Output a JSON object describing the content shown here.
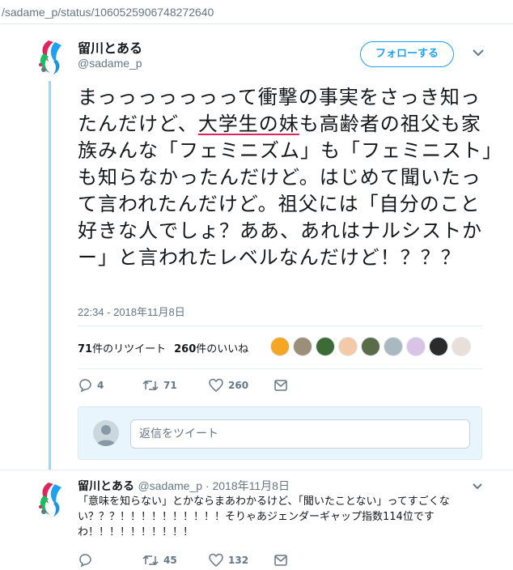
{
  "browser": {
    "url": "/sadame_p/status/1060525906748272640"
  },
  "tweet": {
    "display_name": "留川とある",
    "handle": "@sadame_p",
    "follow_label": "フォローする",
    "text_before": "まっっっっっっって衝撃の事実をさっき知ったんだけど、",
    "text_highlight": "大学生の妹",
    "text_after": "も高齢者の祖父も家族みんな「フェミニズム」も「フェミニスト」も知らなかったんだけど。はじめて聞いたって言われたんだけど。祖父には「自分のこと好きな人でしょ？ああ、あれはナルシストかー」と言われたレベルなんだけど！？？？",
    "timestamp": "22:34 - 2018年11月8日",
    "retweet_count": "71",
    "retweet_suffix": "件のリツイート",
    "like_count": "260",
    "like_suffix": "件のいいね",
    "likers": [
      {
        "color": "#f5a623"
      },
      {
        "color": "#9b8f7a"
      },
      {
        "color": "#3d6b35"
      },
      {
        "color": "#f4c9a8"
      },
      {
        "color": "#5a6b4a"
      },
      {
        "color": "#aab8c2"
      },
      {
        "color": "#d9c3e6"
      },
      {
        "color": "#2b2b2b"
      },
      {
        "color": "#e8e0d8"
      }
    ],
    "actions": {
      "reply": "4",
      "retweet": "71",
      "like": "260"
    }
  },
  "reply_box": {
    "placeholder": "返信をツイート"
  },
  "reply_tweet": {
    "display_name": "留川とある",
    "meta": "@sadame_p · 2018年11月8日",
    "text": "「意味を知らない」とかならまあわかるけど、「聞いたことない」ってすごくない？？？！！！！！！！！！！そりゃあジェンダーギャップ指数114位ですわ！！！！！！！！！！",
    "actions": {
      "reply": "",
      "retweet": "45",
      "like": "132"
    }
  },
  "colors": {
    "accent": "#1da1f2",
    "thread": "#9fd6f6",
    "muted": "#657786",
    "underline": "#e0245e"
  }
}
